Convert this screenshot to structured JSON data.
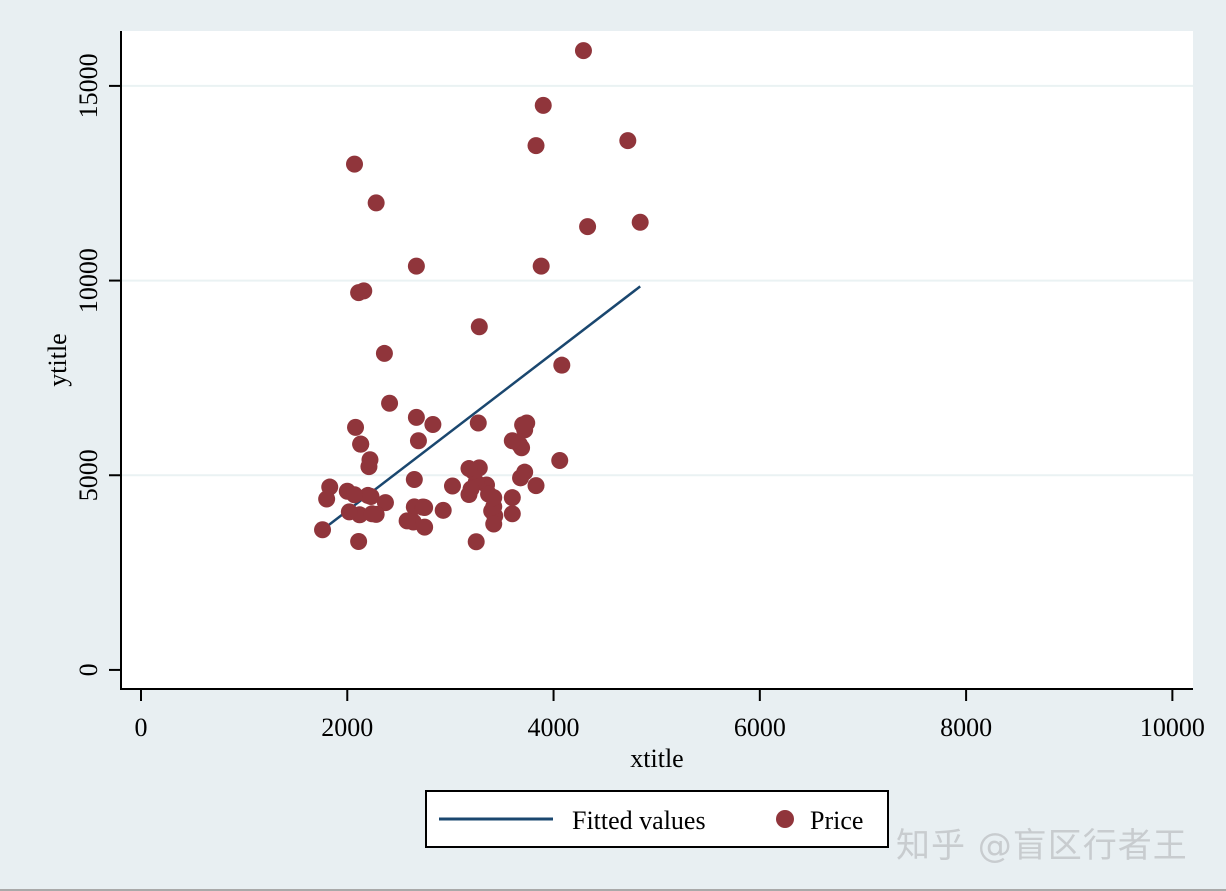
{
  "chart_data": {
    "type": "scatter",
    "title": "",
    "xlabel": "xtitle",
    "ylabel": "ytitle",
    "xlim": [
      -194,
      10200
    ],
    "ylim": [
      -490,
      16410
    ],
    "xticks": [
      0,
      2000,
      4000,
      6000,
      8000,
      10000
    ],
    "xtick_labels": [
      "0",
      "2000",
      "4000",
      "6000",
      "8000",
      "10000"
    ],
    "yticks": [
      0,
      5000,
      10000,
      15000
    ],
    "ytick_labels": [
      "0",
      "5000",
      "10000",
      "15000"
    ],
    "grid": "horizontal",
    "legend": {
      "placement": "bottom-center",
      "entries": [
        {
          "label": "Fitted values",
          "type": "line",
          "color": "#1a476f"
        },
        {
          "label": "Price",
          "type": "marker",
          "color": "#90353b"
        }
      ]
    },
    "series": [
      {
        "name": "Fitted values",
        "type": "line",
        "color": "#1a476f",
        "x": [
          1760,
          4840
        ],
        "y": [
          3600,
          9850
        ]
      },
      {
        "name": "Price",
        "type": "scatter",
        "color": "#90353b",
        "points": [
          [
            2930,
            4099
          ],
          [
            3350,
            4749
          ],
          [
            2640,
            3799
          ],
          [
            3250,
            4816
          ],
          [
            4080,
            7827
          ],
          [
            3670,
            5788
          ],
          [
            2230,
            4453
          ],
          [
            3280,
            5189
          ],
          [
            3880,
            10372
          ],
          [
            3400,
            4082
          ],
          [
            4330,
            11385
          ],
          [
            3900,
            14500
          ],
          [
            4290,
            15906
          ],
          [
            2110,
            3299
          ],
          [
            3690,
            5705
          ],
          [
            3180,
            4504
          ],
          [
            3220,
            5104
          ],
          [
            2750,
            3667
          ],
          [
            3430,
            3955
          ],
          [
            2120,
            3984
          ],
          [
            3600,
            4010
          ],
          [
            3600,
            5886
          ],
          [
            3740,
            6342
          ],
          [
            1800,
            4389
          ],
          [
            2650,
            4187
          ],
          [
            4840,
            11497
          ],
          [
            4720,
            13594
          ],
          [
            3830,
            13466
          ],
          [
            2580,
            3829
          ],
          [
            4060,
            5379
          ],
          [
            3720,
            6165
          ],
          [
            3370,
            4516
          ],
          [
            2830,
            6303
          ],
          [
            3250,
            3291
          ],
          [
            3280,
            8814
          ],
          [
            3180,
            5172
          ],
          [
            3830,
            4733
          ],
          [
            2650,
            4890
          ],
          [
            2730,
            4181
          ],
          [
            3420,
            4195
          ],
          [
            2670,
            10371
          ],
          [
            3200,
            4647
          ],
          [
            3420,
            4425
          ],
          [
            2200,
            4482
          ],
          [
            2670,
            6486
          ],
          [
            2020,
            4060
          ],
          [
            2130,
            5798
          ],
          [
            3680,
            4934
          ],
          [
            2210,
            5222
          ],
          [
            3020,
            4723
          ],
          [
            3600,
            4424
          ],
          [
            2750,
            4172
          ],
          [
            2110,
            9690
          ],
          [
            3700,
            6295
          ],
          [
            2160,
            9735
          ],
          [
            2080,
            6229
          ],
          [
            2000,
            4589
          ],
          [
            3720,
            5079
          ],
          [
            2360,
            8129
          ],
          [
            2370,
            4296
          ],
          [
            2130,
            5799
          ],
          [
            2070,
            4499
          ],
          [
            2280,
            3995
          ],
          [
            2070,
            12990
          ],
          [
            3420,
            3748
          ],
          [
            2220,
            5397
          ],
          [
            1830,
            4697
          ],
          [
            2410,
            6850
          ],
          [
            2280,
            11995
          ],
          [
            2240,
            4010
          ],
          [
            2690,
            5886
          ],
          [
            3270,
            6342
          ],
          [
            1760,
            3600
          ],
          [
            2740,
            4181
          ]
        ]
      }
    ]
  },
  "watermark": "知乎 @盲区行者王"
}
